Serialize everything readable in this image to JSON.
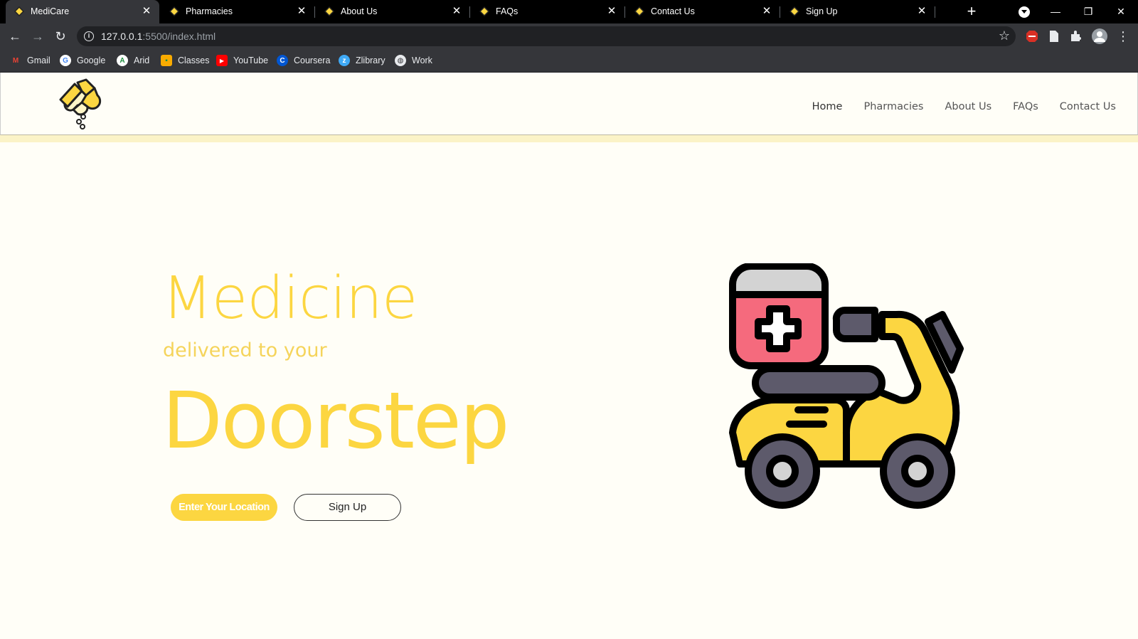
{
  "browser": {
    "tabs": [
      {
        "title": "MediCare",
        "active": true
      },
      {
        "title": "Pharmacies",
        "active": false
      },
      {
        "title": "About Us",
        "active": false
      },
      {
        "title": "FAQs",
        "active": false
      },
      {
        "title": "Contact Us",
        "active": false
      },
      {
        "title": "Sign Up",
        "active": false
      }
    ],
    "address": {
      "host": "127.0.0.1",
      "path": ":5500/index.html"
    },
    "bookmarks": [
      {
        "label": "Gmail",
        "icon": "gmail-icon"
      },
      {
        "label": "Google",
        "icon": "google-icon"
      },
      {
        "label": "Arid",
        "icon": "arid-icon"
      },
      {
        "label": "Classes",
        "icon": "classroom-icon"
      },
      {
        "label": "YouTube",
        "icon": "youtube-icon"
      },
      {
        "label": "Coursera",
        "icon": "coursera-icon"
      },
      {
        "label": "Zlibrary",
        "icon": "zlibrary-icon"
      },
      {
        "label": "Work",
        "icon": "globe-icon"
      }
    ]
  },
  "site": {
    "nav": [
      {
        "label": "Home",
        "current": true
      },
      {
        "label": "Pharmacies",
        "current": false
      },
      {
        "label": "About Us",
        "current": false
      },
      {
        "label": "FAQs",
        "current": false
      },
      {
        "label": "Contact Us",
        "current": false
      }
    ],
    "hero": {
      "headline": "Medicine",
      "subline": "delivered to your",
      "tagline": "Doorstep",
      "location_button": "Enter Your Location",
      "signup_button": "Sign Up"
    }
  },
  "colors": {
    "accent": "#fcd641",
    "background": "#fffef7",
    "medkit": "#f56a7d",
    "scooter_dark": "#5d5a6b"
  }
}
